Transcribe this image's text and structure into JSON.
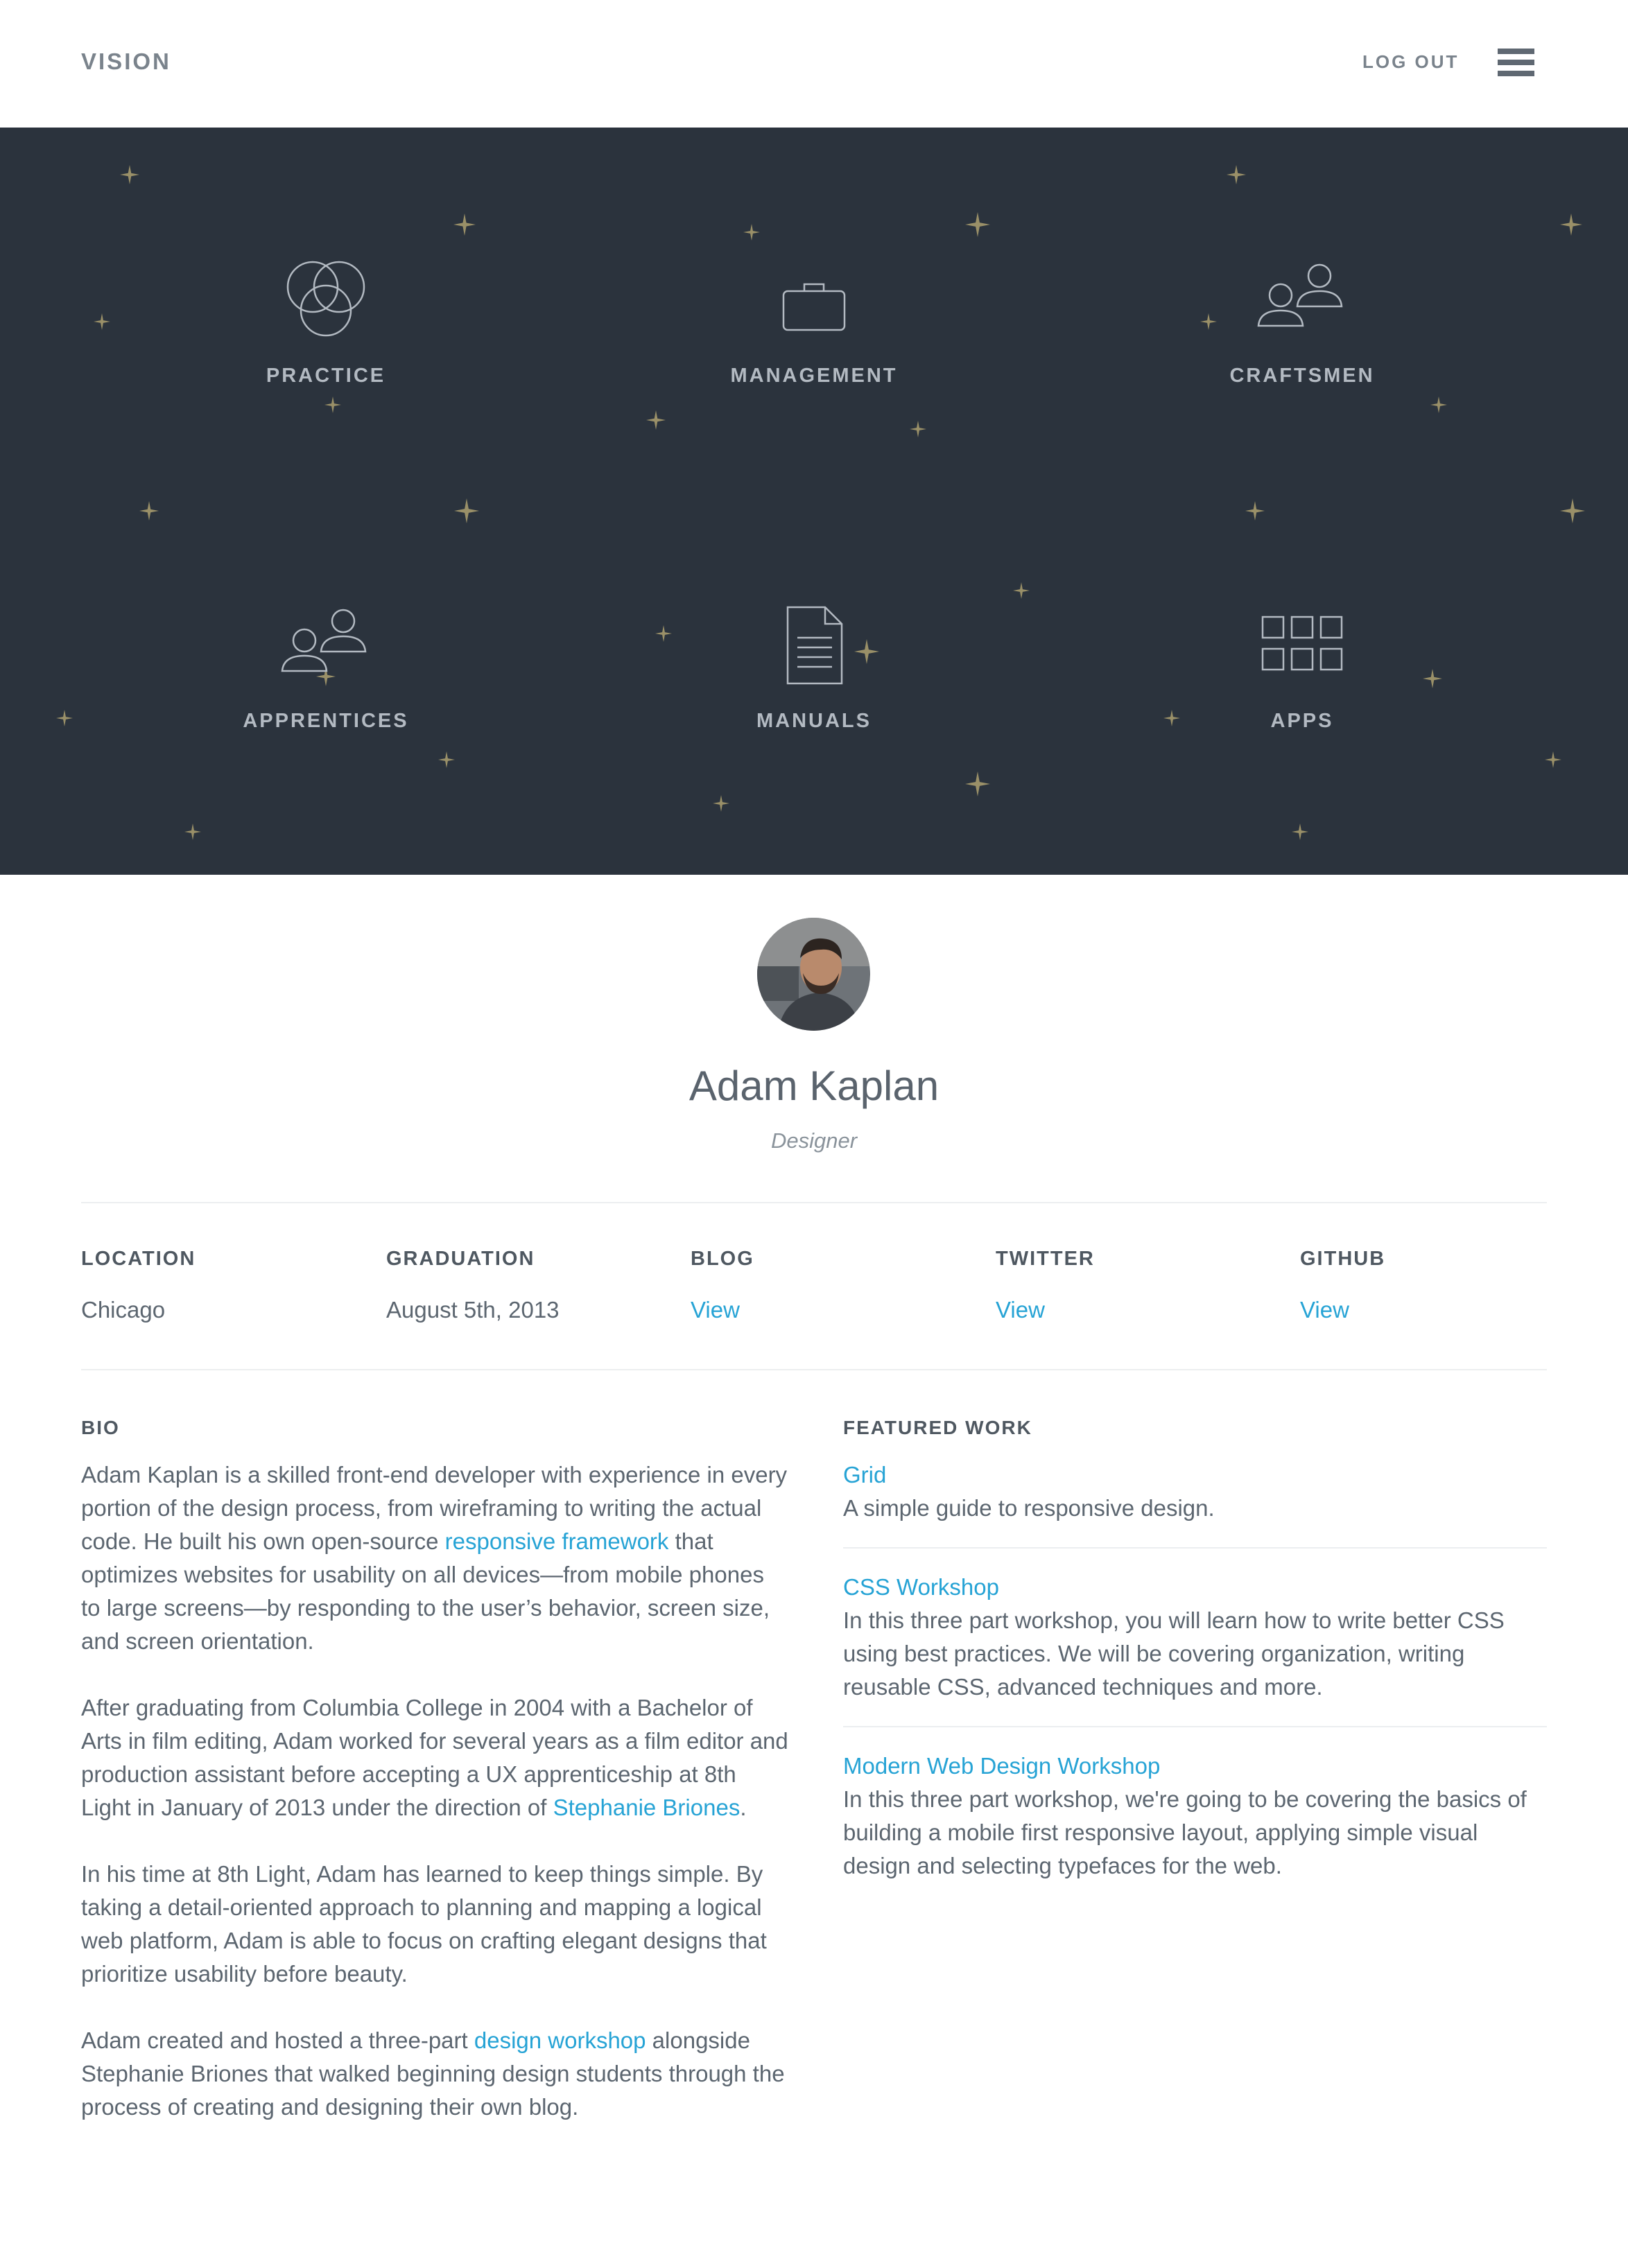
{
  "header": {
    "brand": "VISION",
    "logout": "LOG OUT",
    "menu_icon": "hamburger-icon"
  },
  "hero": {
    "background": "#2b333d",
    "star_color": "#9a9068",
    "tiles": [
      {
        "label": "PRACTICE",
        "icon": "venn-circles-icon"
      },
      {
        "label": "MANAGEMENT",
        "icon": "briefcase-icon"
      },
      {
        "label": "CRAFTSMEN",
        "icon": "people-icon"
      },
      {
        "label": "APPRENTICES",
        "icon": "people-icon"
      },
      {
        "label": "MANUALS",
        "icon": "document-icon"
      },
      {
        "label": "APPS",
        "icon": "grid-icon"
      }
    ]
  },
  "profile": {
    "name": "Adam Kaplan",
    "role": "Designer"
  },
  "stats": {
    "location": {
      "label": "LOCATION",
      "value": "Chicago"
    },
    "graduation": {
      "label": "GRADUATION",
      "value": "August 5th, 2013"
    },
    "blog": {
      "label": "BLOG",
      "value": "View"
    },
    "twitter": {
      "label": "TWITTER",
      "value": "View"
    },
    "github": {
      "label": "GITHUB",
      "value": "View"
    }
  },
  "bio": {
    "title": "BIO",
    "p1_a": "Adam Kaplan is a skilled front-end developer with experience in every portion of the design process, from wireframing to writing the actual code. He built his own open-source ",
    "p1_link": "responsive framework",
    "p1_b": " that optimizes websites for usability on all devices—from mobile phones to large screens—by responding to the user’s behavior, screen size, and screen orientation.",
    "p2_a": "After graduating from Columbia College in 2004 with a Bachelor of Arts in film editing, Adam worked for several years as a film editor and production assistant before accepting a UX apprenticeship at 8th Light in January of 2013 under the direction of ",
    "p2_link": "Stephanie Briones",
    "p2_b": ".",
    "p3": "In his time at 8th Light, Adam has learned to keep things simple. By taking a detail-oriented approach to planning and mapping a logical web platform, Adam is able to focus on crafting elegant designs that prioritize usability before beauty.",
    "p4_a": "Adam created and hosted a three-part ",
    "p4_link": "design workshop",
    "p4_b": " alongside Stephanie Briones that walked beginning design students through the process of creating and designing their own blog."
  },
  "featured": {
    "title": "FEATURED WORK",
    "items": [
      {
        "title": "Grid",
        "desc": "A simple guide to responsive design."
      },
      {
        "title": "CSS Workshop",
        "desc": "In this three part workshop, you will learn how to write better CSS using best practices. We will be covering organization, writing reusable CSS, advanced techniques and more."
      },
      {
        "title": "Modern Web Design Workshop",
        "desc": "In this three part workshop, we're going to be covering the basics of building a mobile first responsive layout, applying simple visual design and selecting typefaces for the web."
      }
    ]
  },
  "colors": {
    "accent": "#26a3d5",
    "text": "#5c6670",
    "heading": "#4f5861"
  }
}
